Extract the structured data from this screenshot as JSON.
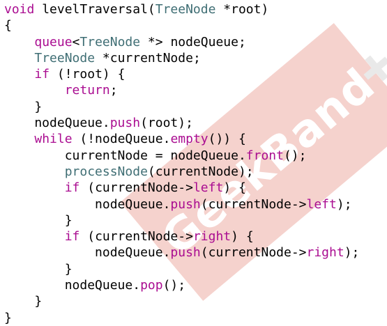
{
  "watermark": {
    "text": "GeekBand"
  },
  "code": {
    "lines": [
      [
        [
          "void",
          "kw"
        ],
        [
          " levelTraversal(",
          ""
        ],
        [
          "TreeNode",
          "ty"
        ],
        [
          " *root)",
          ""
        ]
      ],
      [
        [
          "{",
          ""
        ]
      ],
      [
        [
          "    ",
          ""
        ],
        [
          "queue",
          "kw"
        ],
        [
          "<",
          ""
        ],
        [
          "TreeNode",
          "ty"
        ],
        [
          " *> nodeQueue;",
          ""
        ]
      ],
      [
        [
          "    ",
          ""
        ],
        [
          "TreeNode",
          "ty"
        ],
        [
          " *currentNode;",
          ""
        ]
      ],
      [
        [
          "    ",
          ""
        ],
        [
          "if",
          "kw"
        ],
        [
          " (!root) {",
          ""
        ]
      ],
      [
        [
          "        ",
          ""
        ],
        [
          "return",
          "kw"
        ],
        [
          ";",
          ""
        ]
      ],
      [
        [
          "    }",
          ""
        ]
      ],
      [
        [
          "    nodeQueue.",
          ""
        ],
        [
          "push",
          "mt"
        ],
        [
          "(root);",
          ""
        ]
      ],
      [
        [
          "    ",
          ""
        ],
        [
          "while",
          "kw"
        ],
        [
          " (!nodeQueue.",
          ""
        ],
        [
          "empty",
          "mt"
        ],
        [
          "()) {",
          ""
        ]
      ],
      [
        [
          "        currentNode = nodeQueue.",
          ""
        ],
        [
          "front",
          "mt"
        ],
        [
          "();",
          ""
        ]
      ],
      [
        [
          "        ",
          ""
        ],
        [
          "processNode",
          "ty"
        ],
        [
          "(currentNode);",
          ""
        ]
      ],
      [
        [
          "        ",
          ""
        ],
        [
          "if",
          "kw"
        ],
        [
          " (currentNode->",
          ""
        ],
        [
          "left",
          "mt"
        ],
        [
          ") {",
          ""
        ]
      ],
      [
        [
          "            nodeQueue.",
          ""
        ],
        [
          "push",
          "mt"
        ],
        [
          "(currentNode->",
          ""
        ],
        [
          "left",
          "mt"
        ],
        [
          ");",
          ""
        ]
      ],
      [
        [
          "        }",
          ""
        ]
      ],
      [
        [
          "        ",
          ""
        ],
        [
          "if",
          "kw"
        ],
        [
          " (currentNode->",
          ""
        ],
        [
          "right",
          "mt"
        ],
        [
          ") {",
          ""
        ]
      ],
      [
        [
          "            nodeQueue.",
          ""
        ],
        [
          "push",
          "mt"
        ],
        [
          "(currentNode->",
          ""
        ],
        [
          "right",
          "mt"
        ],
        [
          ");",
          ""
        ]
      ],
      [
        [
          "        }",
          ""
        ]
      ],
      [
        [
          "        nodeQueue.",
          ""
        ],
        [
          "pop",
          "mt"
        ],
        [
          "();",
          ""
        ]
      ],
      [
        [
          "    }",
          ""
        ]
      ],
      [
        [
          "}",
          ""
        ]
      ]
    ]
  }
}
